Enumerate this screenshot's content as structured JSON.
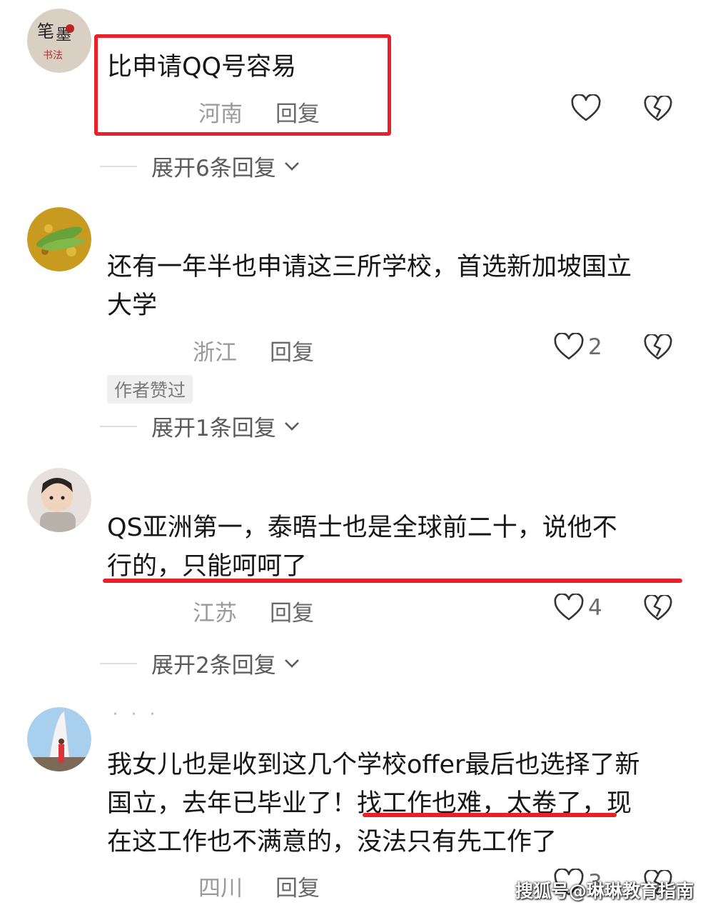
{
  "comments": [
    {
      "text_lines": [
        "比申请QQ号容易"
      ],
      "location": "河南",
      "reply_label": "回复",
      "likes": "",
      "expand_label": "展开6条回复"
    },
    {
      "text_lines": [
        "还有一年半也申请这三所学校，首选新加坡国立",
        "大学"
      ],
      "location": "浙江",
      "reply_label": "回复",
      "likes": "2",
      "author_badge": "作者赞过",
      "expand_label": "展开1条回复"
    },
    {
      "text_lines": [
        "QS亚洲第一，泰晤士也是全球前二十，说他不",
        "行的，只能呵呵了"
      ],
      "location": "江苏",
      "reply_label": "回复",
      "likes": "4",
      "expand_label": "展开2条回复"
    },
    {
      "text_lines": [
        "我女儿也是收到这几个学校offer最后也选择了新",
        "国立，去年已毕业了！找工作也难，太卷了，现",
        "在这工作也不满意的，没法只有先工作了"
      ],
      "location": "四川",
      "reply_label": "回复",
      "likes": "3"
    }
  ],
  "watermark": "搜狐号@琳琳教育指南",
  "colors": {
    "highlight": "#e8202a",
    "text": "#161616",
    "meta": "#9a9a9a"
  },
  "icons": [
    "heart-icon",
    "broken-heart-icon",
    "chevron-down-icon"
  ]
}
